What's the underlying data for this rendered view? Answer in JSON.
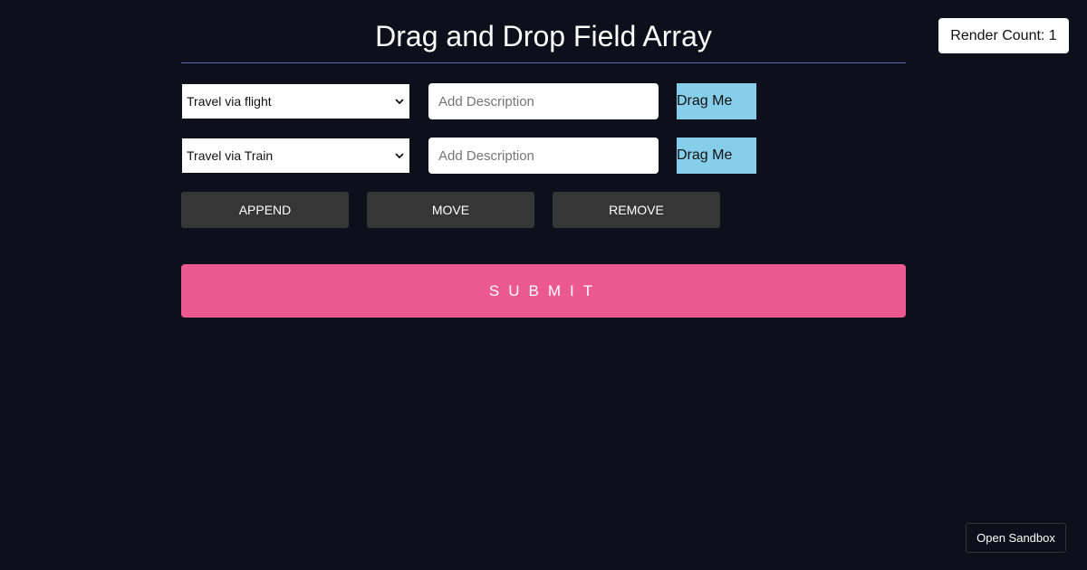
{
  "header": {
    "title": "Drag and Drop Field Array",
    "render_count": "Render Count: 1"
  },
  "fields": [
    {
      "select_value": "Travel via flight",
      "description_placeholder": "Add Description",
      "drag_label": "Drag Me"
    },
    {
      "select_value": "Travel via Train",
      "description_placeholder": "Add Description",
      "drag_label": "Drag Me"
    }
  ],
  "actions": {
    "append_label": "APPEND",
    "move_label": "MOVE",
    "remove_label": "REMOVE"
  },
  "submit": {
    "label": "SUBMIT"
  },
  "footer": {
    "sandbox_label": "Open Sandbox"
  },
  "colors": {
    "background": "#0d0f1a",
    "submit": "#ec5990",
    "drag_handle": "#87ceeb",
    "action_button": "#363636",
    "divider": "#5c6bc0"
  },
  "icons": {
    "select_arrow": "chevron-down-icon"
  }
}
